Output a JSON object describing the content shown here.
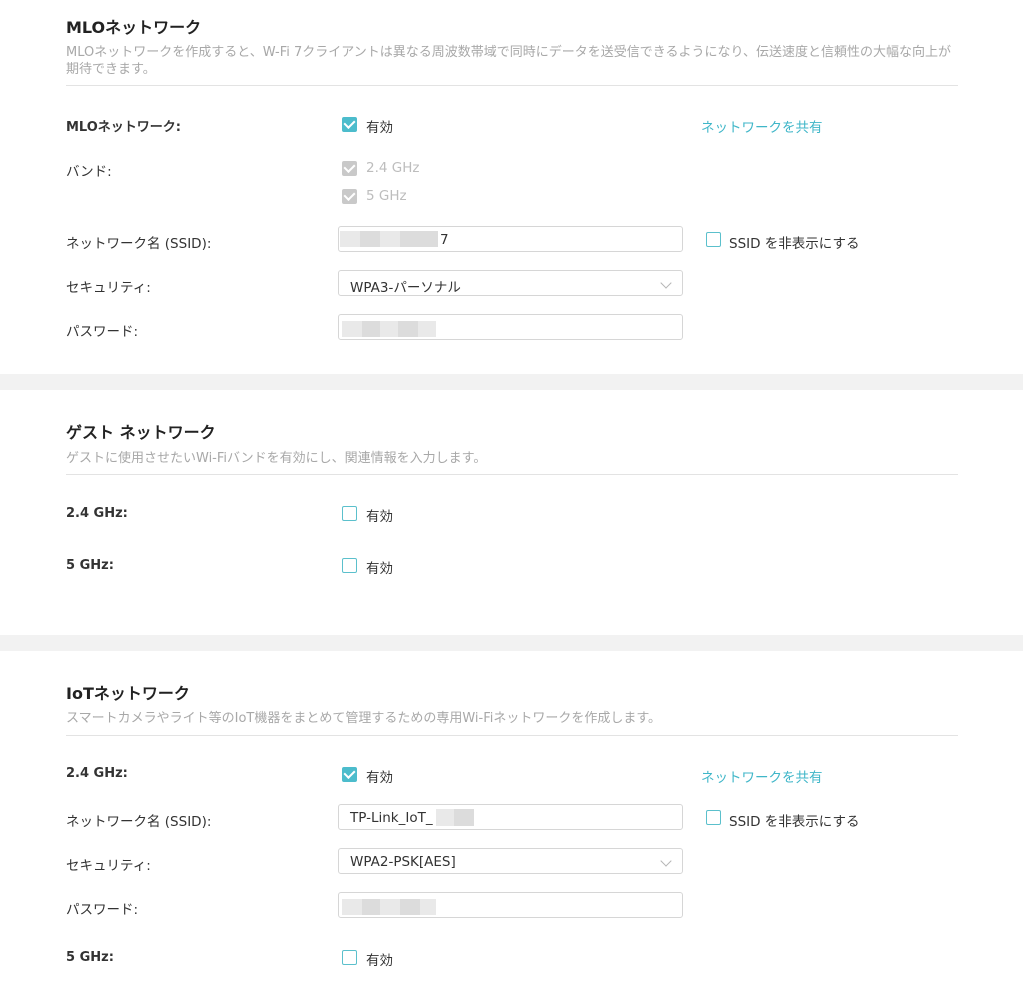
{
  "mlo": {
    "title": "MLOネットワーク",
    "desc": "MLOネットワークを作成すると、W-Fi 7クライアントは異なる周波数帯域で同時にデータを送受信できるようになり、伝送速度と信頼性の大幅な向上が期待できます。",
    "enable_label": "MLOネットワーク:",
    "enable_text": "有効",
    "share": "ネットワークを共有",
    "band_label": "バンド:",
    "band_24": "2.4 GHz",
    "band_5": "5 GHz",
    "ssid_label": "ネットワーク名 (SSID):",
    "ssid_value": "7",
    "hide_ssid": "SSID を非表示にする",
    "security_label": "セキュリティ:",
    "security_value": "WPA3-パーソナル",
    "password_label": "パスワード:"
  },
  "guest": {
    "title": "ゲスト ネットワーク",
    "desc": "ゲストに使用させたいWi-Fiバンドを有効にし、関連情報を入力します。",
    "g24_label": "2.4 GHz:",
    "g24_text": "有効",
    "g5_label": "5 GHz:",
    "g5_text": "有効"
  },
  "iot": {
    "title": "IoTネットワーク",
    "desc": "スマートカメラやライト等のIoT機器をまとめて管理するための専用Wi-Fiネットワークを作成します。",
    "i24_label": "2.4 GHz:",
    "i24_text": "有効",
    "share": "ネットワークを共有",
    "ssid_label": "ネットワーク名 (SSID):",
    "ssid_value": "TP-Link_IoT_",
    "hide_ssid": "SSID を非表示にする",
    "security_label": "セキュリティ:",
    "security_value": "WPA2-PSK[AES]",
    "password_label": "パスワード:",
    "i5_label": "5 GHz:",
    "i5_text": "有効"
  },
  "colors": {
    "accent": "#4cbccc",
    "separator": "#f2f2f2"
  },
  "icons": {
    "checkbox": "checkbox-icon",
    "chevron": "chevron-down-icon"
  }
}
